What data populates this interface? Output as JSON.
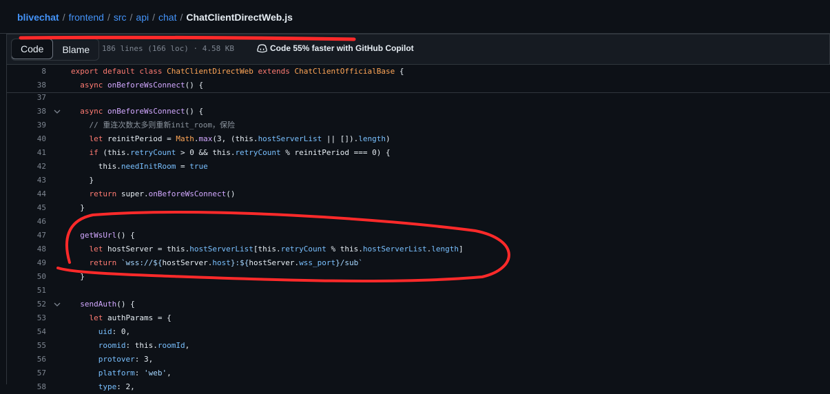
{
  "breadcrumb": {
    "items": [
      "blivechat",
      "frontend",
      "src",
      "api",
      "chat"
    ],
    "separator": "/",
    "file": "ChatClientDirectWeb.js"
  },
  "toolbar": {
    "code_label": "Code",
    "blame_label": "Blame",
    "file_info": "186 lines (166 loc) · 4.58 KB",
    "copilot_text": "Code 55% faster with GitHub Copilot"
  },
  "sticky_lines": [
    {
      "num": "8",
      "tokens": [
        {
          "t": "export ",
          "c": "kw"
        },
        {
          "t": "default ",
          "c": "kw"
        },
        {
          "t": "class ",
          "c": "kw"
        },
        {
          "t": "ChatClientDirectWeb",
          "c": "ty"
        },
        {
          "t": " extends ",
          "c": "kw"
        },
        {
          "t": "ChatClientOfficialBase",
          "c": "ty"
        },
        {
          "t": " {",
          "c": ""
        }
      ]
    },
    {
      "num": "38",
      "tokens": [
        {
          "t": "  async ",
          "c": "kw"
        },
        {
          "t": "onBeforeWsConnect",
          "c": "fn"
        },
        {
          "t": "() {",
          "c": ""
        }
      ]
    }
  ],
  "lines": [
    {
      "num": "37",
      "tokens": []
    },
    {
      "num": "38",
      "fold": true,
      "tokens": [
        {
          "t": "  async ",
          "c": "kw"
        },
        {
          "t": "onBeforeWsConnect",
          "c": "fn"
        },
        {
          "t": "() {",
          "c": ""
        }
      ]
    },
    {
      "num": "39",
      "tokens": [
        {
          "t": "    // 重连次数太多则重新init_room，保险",
          "c": "cm"
        }
      ]
    },
    {
      "num": "40",
      "tokens": [
        {
          "t": "    let ",
          "c": "kw"
        },
        {
          "t": "reinitPeriod = ",
          "c": ""
        },
        {
          "t": "Math",
          "c": "ty"
        },
        {
          "t": ".",
          "c": ""
        },
        {
          "t": "max",
          "c": "fn"
        },
        {
          "t": "(3, (this.",
          "c": ""
        },
        {
          "t": "hostServerList",
          "c": "pr"
        },
        {
          "t": " || []).",
          "c": ""
        },
        {
          "t": "length",
          "c": "pr"
        },
        {
          "t": ")",
          "c": ""
        }
      ]
    },
    {
      "num": "41",
      "tokens": [
        {
          "t": "    if ",
          "c": "kw"
        },
        {
          "t": "(this.",
          "c": ""
        },
        {
          "t": "retryCount",
          "c": "pr"
        },
        {
          "t": " > 0 && this.",
          "c": ""
        },
        {
          "t": "retryCount",
          "c": "pr"
        },
        {
          "t": " % reinitPeriod === 0) {",
          "c": ""
        }
      ]
    },
    {
      "num": "42",
      "tokens": [
        {
          "t": "      this.",
          "c": ""
        },
        {
          "t": "needInitRoom",
          "c": "pr"
        },
        {
          "t": " = ",
          "c": ""
        },
        {
          "t": "true",
          "c": "pr"
        }
      ]
    },
    {
      "num": "43",
      "tokens": [
        {
          "t": "    }",
          "c": ""
        }
      ]
    },
    {
      "num": "44",
      "tokens": [
        {
          "t": "    return ",
          "c": "kw"
        },
        {
          "t": "super.",
          "c": ""
        },
        {
          "t": "onBeforeWsConnect",
          "c": "fn"
        },
        {
          "t": "()",
          "c": ""
        }
      ]
    },
    {
      "num": "45",
      "tokens": [
        {
          "t": "  }",
          "c": ""
        }
      ]
    },
    {
      "num": "46",
      "tokens": []
    },
    {
      "num": "47",
      "tokens": [
        {
          "t": "  getWsUrl",
          "c": "fn"
        },
        {
          "t": "() {",
          "c": ""
        }
      ]
    },
    {
      "num": "48",
      "tokens": [
        {
          "t": "    let ",
          "c": "kw"
        },
        {
          "t": "hostServer = this.",
          "c": ""
        },
        {
          "t": "hostServerList",
          "c": "pr"
        },
        {
          "t": "[this.",
          "c": ""
        },
        {
          "t": "retryCount",
          "c": "pr"
        },
        {
          "t": " % this.",
          "c": ""
        },
        {
          "t": "hostServerList",
          "c": "pr"
        },
        {
          "t": ".",
          "c": ""
        },
        {
          "t": "length",
          "c": "pr"
        },
        {
          "t": "]",
          "c": ""
        }
      ]
    },
    {
      "num": "49",
      "tokens": [
        {
          "t": "    return ",
          "c": "kw"
        },
        {
          "t": "`wss://${",
          "c": "st"
        },
        {
          "t": "hostServer.",
          "c": ""
        },
        {
          "t": "host",
          "c": "pr"
        },
        {
          "t": "}:${",
          "c": "st"
        },
        {
          "t": "hostServer.",
          "c": ""
        },
        {
          "t": "wss_port",
          "c": "pr"
        },
        {
          "t": "}/sub`",
          "c": "st"
        }
      ]
    },
    {
      "num": "50",
      "tokens": [
        {
          "t": "  }",
          "c": ""
        }
      ]
    },
    {
      "num": "51",
      "tokens": []
    },
    {
      "num": "52",
      "fold": true,
      "tokens": [
        {
          "t": "  sendAuth",
          "c": "fn"
        },
        {
          "t": "() {",
          "c": ""
        }
      ]
    },
    {
      "num": "53",
      "tokens": [
        {
          "t": "    let ",
          "c": "kw"
        },
        {
          "t": "authParams = {",
          "c": ""
        }
      ]
    },
    {
      "num": "54",
      "tokens": [
        {
          "t": "      uid",
          "c": "pr"
        },
        {
          "t": ": 0,",
          "c": ""
        }
      ]
    },
    {
      "num": "55",
      "tokens": [
        {
          "t": "      roomid",
          "c": "pr"
        },
        {
          "t": ": this.",
          "c": ""
        },
        {
          "t": "roomId",
          "c": "pr"
        },
        {
          "t": ",",
          "c": ""
        }
      ]
    },
    {
      "num": "56",
      "tokens": [
        {
          "t": "      protover",
          "c": "pr"
        },
        {
          "t": ": 3,",
          "c": ""
        }
      ]
    },
    {
      "num": "57",
      "tokens": [
        {
          "t": "      platform",
          "c": "pr"
        },
        {
          "t": ": ",
          "c": ""
        },
        {
          "t": "'web'",
          "c": "st"
        },
        {
          "t": ",",
          "c": ""
        }
      ]
    },
    {
      "num": "58",
      "tokens": [
        {
          "t": "      type",
          "c": "pr"
        },
        {
          "t": ": 2,",
          "c": ""
        }
      ]
    }
  ],
  "colors": {
    "background": "#0d1117",
    "link": "#4493f8",
    "annotation": "#ff2a2a"
  }
}
